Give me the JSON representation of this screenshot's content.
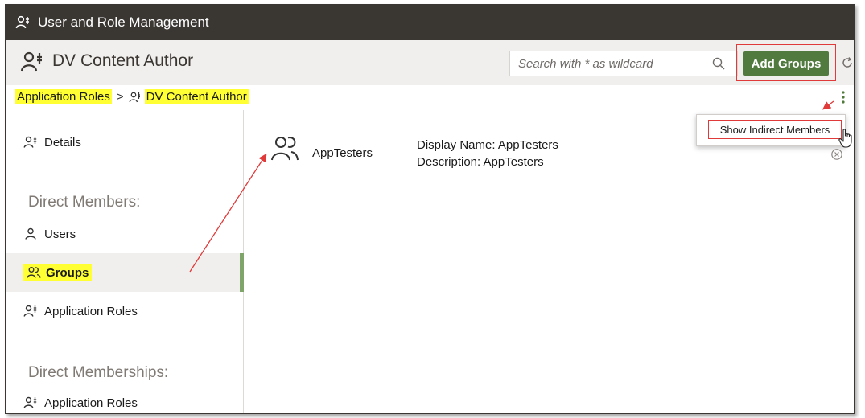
{
  "window": {
    "title": "User and Role Management"
  },
  "header": {
    "title": "DV Content Author",
    "search_placeholder": "Search with * as wildcard",
    "add_button_label": "Add Groups"
  },
  "breadcrumb": {
    "root": "Application Roles",
    "separator": ">",
    "current": "DV Content Author"
  },
  "sidebar": {
    "details_label": "Details",
    "direct_members_heading": "Direct Members:",
    "members": [
      {
        "label": "Users",
        "icon": "user-icon"
      },
      {
        "label": "Groups",
        "icon": "group-icon",
        "active": true
      },
      {
        "label": "Application Roles",
        "icon": "app-role-icon"
      }
    ],
    "direct_memberships_heading": "Direct Memberships:",
    "memberships": [
      {
        "label": "Application Roles",
        "icon": "app-role-icon"
      }
    ]
  },
  "content": {
    "items": [
      {
        "name": "AppTesters",
        "display_name_label": "Display Name:",
        "display_name": "AppTesters",
        "description_label": "Description:",
        "description": "AppTesters"
      }
    ]
  },
  "menu": {
    "items": [
      {
        "label": "Show Indirect Members"
      }
    ]
  },
  "colors": {
    "titlebar": "#3a3632",
    "header_bg": "#f1efed",
    "add_button": "#517a3e",
    "highlight": "#ffff33",
    "annotation_red": "#e03a3a",
    "active_bar": "#7fa56b"
  }
}
